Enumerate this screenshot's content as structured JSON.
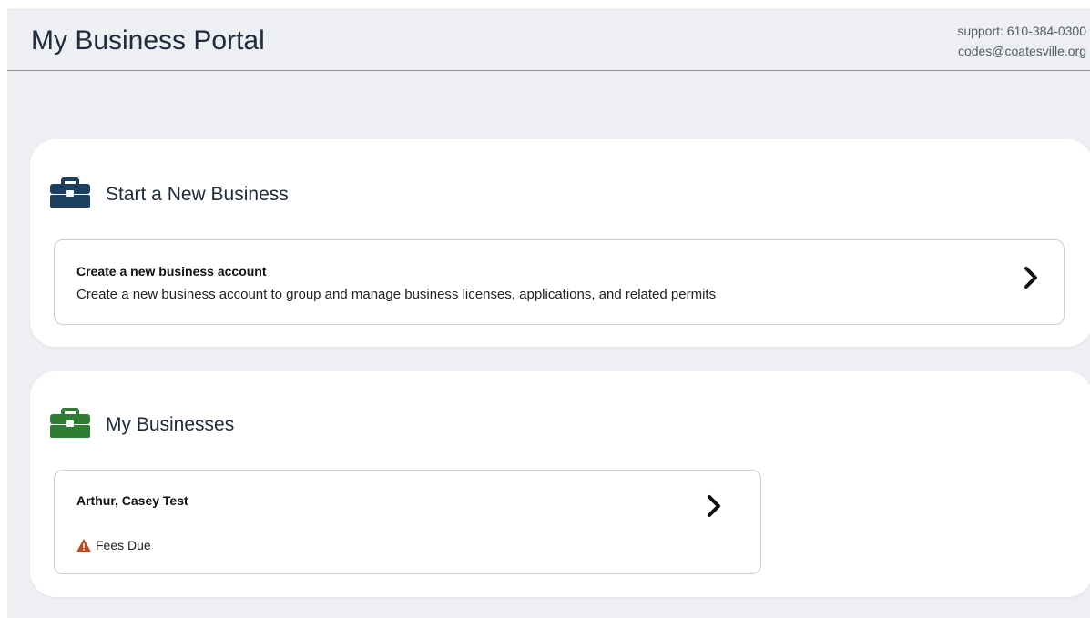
{
  "header": {
    "title": "My Business Portal",
    "support_phone": "support: 610-384-0300",
    "support_email": "codes@coatesville.org"
  },
  "start_section": {
    "title": "Start a New Business",
    "icon": "briefcase-icon",
    "icon_color": "#1b3f5e",
    "item": {
      "title": "Create a new business account",
      "description": "Create a new business account to group and manage business licenses, applications, and related permits"
    }
  },
  "my_businesses": {
    "title": "My Businesses",
    "icon": "briefcase-icon",
    "icon_color": "#2f7d32",
    "items": [
      {
        "name": "Arthur, Casey Test",
        "status": "Fees Due",
        "status_icon": "warning-icon",
        "status_color": "#c4471f"
      }
    ]
  }
}
